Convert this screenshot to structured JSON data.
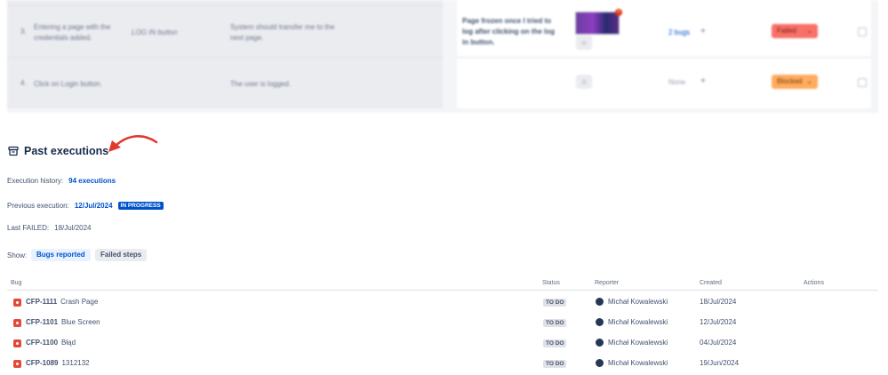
{
  "steps": [
    {
      "num": "3.",
      "action": "Entering a page with the credentials added.",
      "data": "LOG IN button",
      "expected": "System should transfer me to the next page.",
      "actual": "Page frozen once I tried to log after clicking on the log in button.",
      "bugs": "2 bugs",
      "status": "Failed"
    },
    {
      "num": "4.",
      "action": "Click on Login button.",
      "data": "",
      "expected": "The user is logged.",
      "actual": "",
      "bugs": "None",
      "status": "Blocked"
    }
  ],
  "past": {
    "title": "Past executions",
    "history_label": "Execution history:",
    "history_value": "94 executions",
    "previous_label": "Previous execution:",
    "previous_value": "12/Jul/2024",
    "previous_badge": "IN PROGRESS",
    "last_failed_label": "Last FAILED:",
    "last_failed_value": "18/Jul/2024",
    "show_label": "Show:",
    "tabs": [
      "Bugs reported",
      "Failed steps"
    ]
  },
  "table": {
    "headers": [
      "Bug",
      "Status",
      "Reporter",
      "Created",
      "Actions"
    ],
    "rows": [
      {
        "key": "CFP-1111",
        "summary": "Crash Page",
        "status": "TO DO",
        "reporter": "Michał Kowalewski",
        "created": "18/Jul/2024"
      },
      {
        "key": "CFP-1101",
        "summary": "Blue Screen",
        "status": "TO DO",
        "reporter": "Michał Kowalewski",
        "created": "12/Jul/2024"
      },
      {
        "key": "CFP-1100",
        "summary": "Błąd",
        "status": "TO DO",
        "reporter": "Michał Kowalewski",
        "created": "04/Jul/2024"
      },
      {
        "key": "CFP-1089",
        "summary": "1312132",
        "status": "TO DO",
        "reporter": "Michał Kowalewski",
        "created": "19/Jun/2024"
      }
    ]
  },
  "colors": {
    "link": "#0052cc",
    "failed": "#f87168",
    "blocked": "#ffab60",
    "bug": "#e5493a",
    "arrow": "#e03a2f"
  },
  "icons": {
    "section": "archive-icon",
    "bug": "bug-type-icon",
    "attach": "attachment-icon",
    "add": "plus-icon",
    "dropdown": "chevron-down-icon"
  }
}
